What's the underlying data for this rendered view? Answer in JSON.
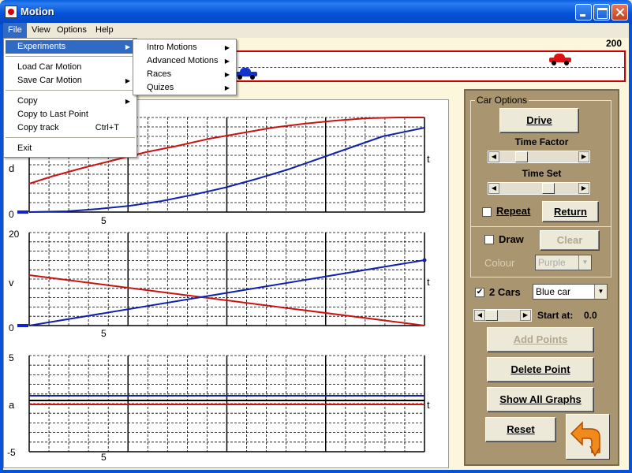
{
  "window": {
    "title": "Motion"
  },
  "menubar": {
    "file": "File",
    "view": "View",
    "options": "Options",
    "help": "Help"
  },
  "file_menu": {
    "experiments": "Experiments",
    "load": "Load Car Motion",
    "save": "Save Car Motion",
    "copy": "Copy",
    "copy_last": "Copy to Last Point",
    "copy_track": "Copy track",
    "copy_track_shortcut": "Ctrl+T",
    "exit": "Exit"
  },
  "experiments_menu": {
    "intro": "Intro Motions",
    "advanced": "Advanced Motions",
    "races": "Races",
    "quizes": "Quizes"
  },
  "track": {
    "max_label": "200",
    "colors": {
      "red_car": "#dd1111",
      "blue_car": "#1133cc"
    }
  },
  "graphs": {
    "d": {
      "axis_label": "d",
      "t_label": "t",
      "y_min_label": "0",
      "x_tick_label": "5"
    },
    "v": {
      "axis_label": "v",
      "t_label": "t",
      "y_max_label": "20",
      "y_min_label": "0",
      "x_tick_label": "5"
    },
    "a": {
      "axis_label": "a",
      "t_label": "t",
      "y_max_label": "5",
      "y_min_label": "-5",
      "x_tick_label": "5"
    }
  },
  "controls": {
    "car_options_title": "Car Options",
    "drive": "Drive",
    "time_factor": "Time Factor",
    "time_set": "Time Set",
    "repeat": "Repeat",
    "return": "Return",
    "draw": "Draw",
    "clear": "Clear",
    "colour": "Colour",
    "colour_value": "Purple",
    "two_cars": "2 Cars",
    "car_select": "Blue car",
    "start_at": "Start at:",
    "start_value": "0.0",
    "add_points": "Add Points",
    "delete_point": "Delete Point",
    "show_all_graphs": "Show All Graphs",
    "reset": "Reset"
  }
}
